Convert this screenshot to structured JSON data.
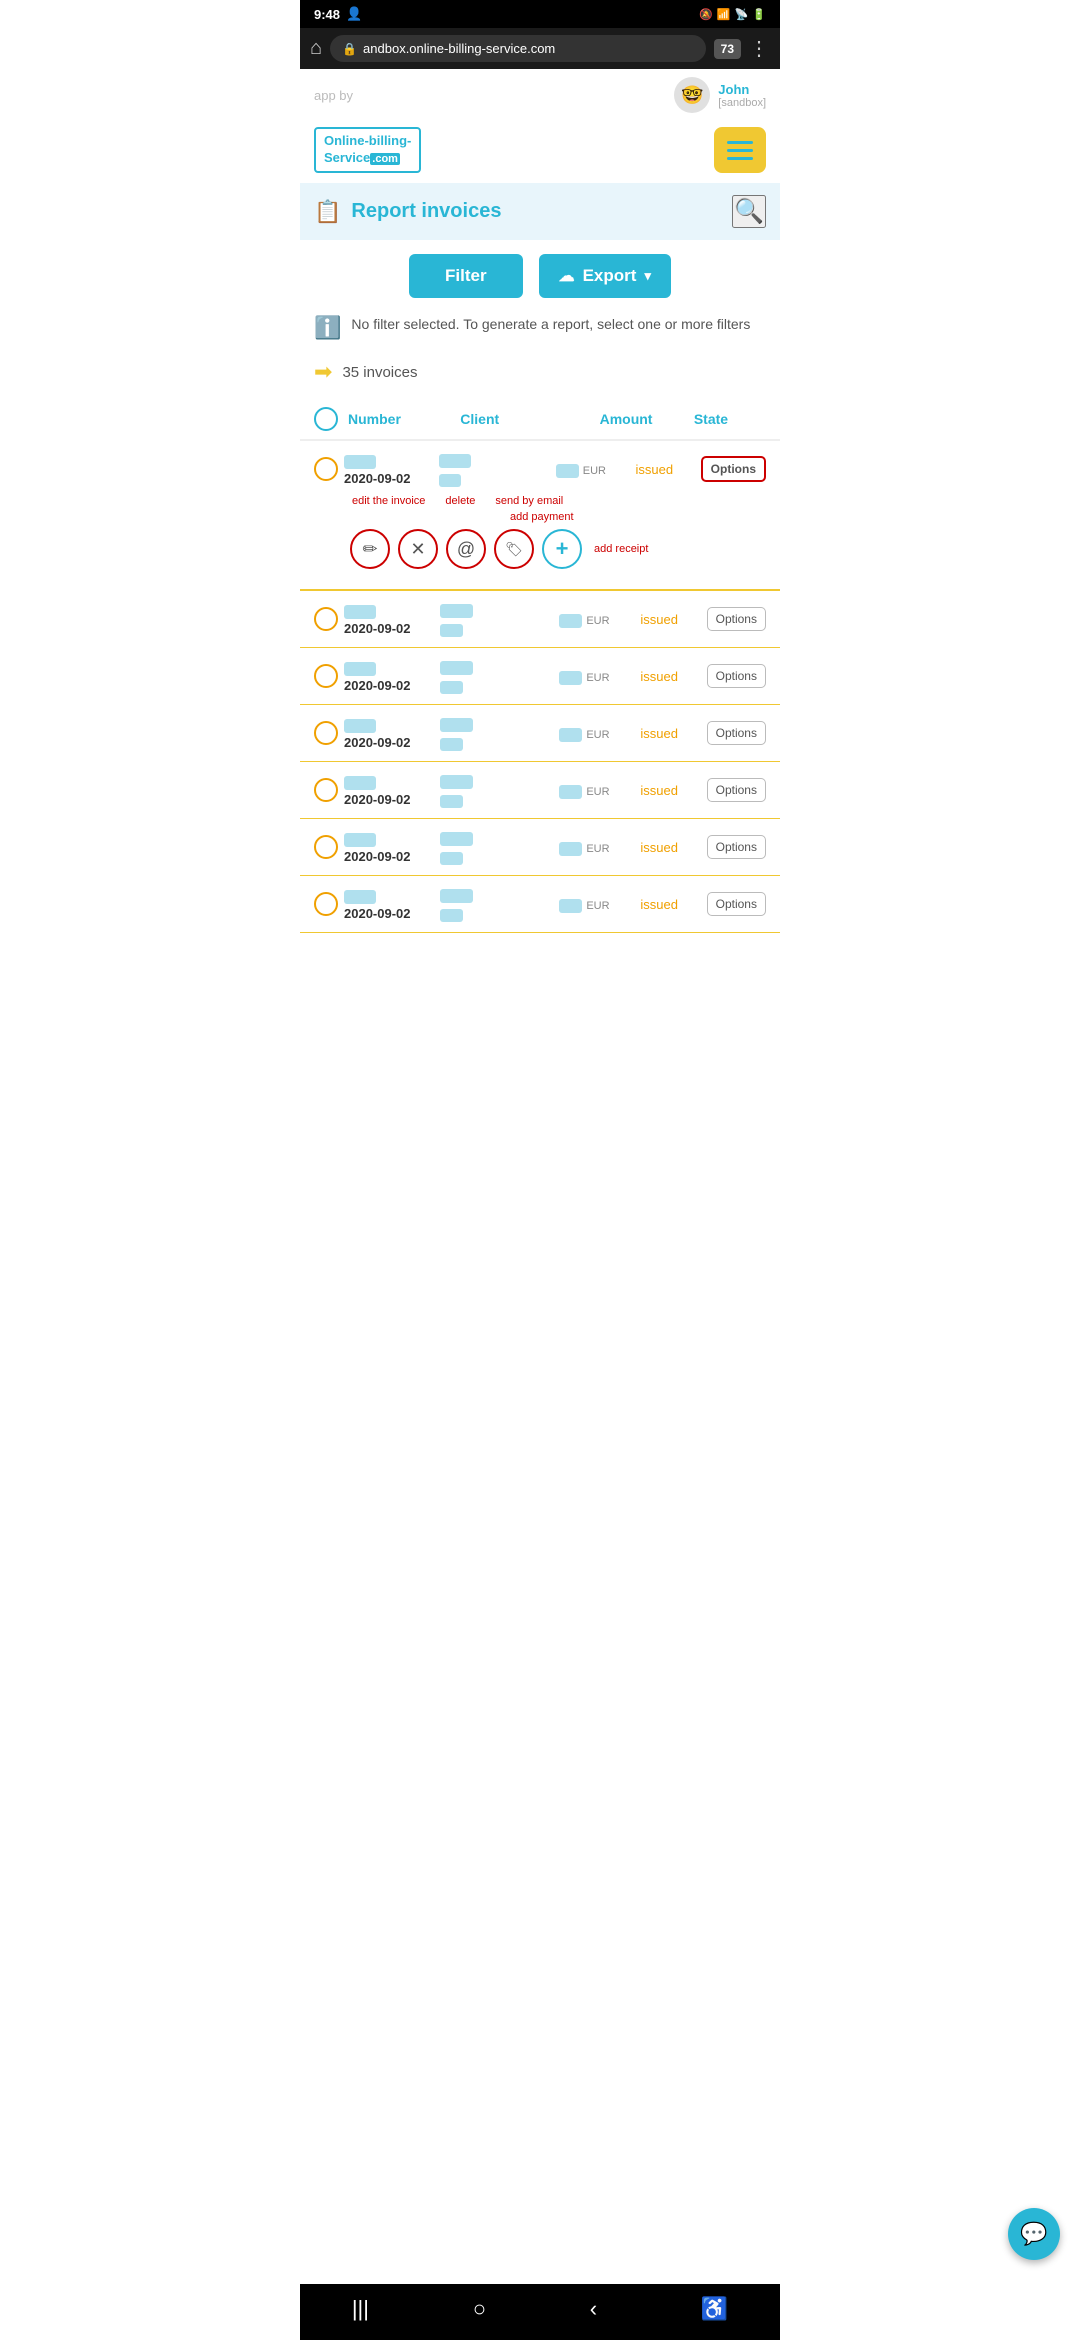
{
  "statusBar": {
    "time": "9:48",
    "tabCount": "73"
  },
  "browserBar": {
    "url": "andbox.online-billing-service.com"
  },
  "header": {
    "appBy": "app by",
    "userName": "John",
    "userSubtitle": "[sandbox]"
  },
  "logo": {
    "line1": "Online-billing-",
    "line2": "Service",
    "tld": ".com"
  },
  "pageTitle": {
    "label": "Report invoices"
  },
  "buttons": {
    "filter": "Filter",
    "export": "Export"
  },
  "infoMessage": "No filter selected. To generate a report, select one or more filters",
  "invoiceCount": "35 invoices",
  "tableHeaders": {
    "number": "Number",
    "client": "Client",
    "amount": "Amount",
    "state": "State"
  },
  "invoices": [
    {
      "id": 1,
      "date": "2020-09-02",
      "state": "issued",
      "expanded": true
    },
    {
      "id": 2,
      "date": "2020-09-02",
      "state": "issued",
      "expanded": false
    },
    {
      "id": 3,
      "date": "2020-09-02",
      "state": "issued",
      "expanded": false
    },
    {
      "id": 4,
      "date": "2020-09-02",
      "state": "issued",
      "expanded": false
    },
    {
      "id": 5,
      "date": "2020-09-02",
      "state": "issued",
      "expanded": false
    },
    {
      "id": 6,
      "date": "2020-09-02",
      "state": "issued",
      "expanded": false
    },
    {
      "id": 7,
      "date": "2020-09-02",
      "state": "issued",
      "expanded": false
    }
  ],
  "actionLabels": {
    "editInvoice": "edit the invoice",
    "delete": "delete",
    "sendByEmail": "send by email",
    "addPayment": "add payment",
    "addReceipt": "add receipt"
  },
  "optionsLabel": "Options",
  "chatIcon": "💬",
  "bottomNav": {
    "menu": "|||",
    "home": "○",
    "back": "‹",
    "accessibility": "♿"
  }
}
